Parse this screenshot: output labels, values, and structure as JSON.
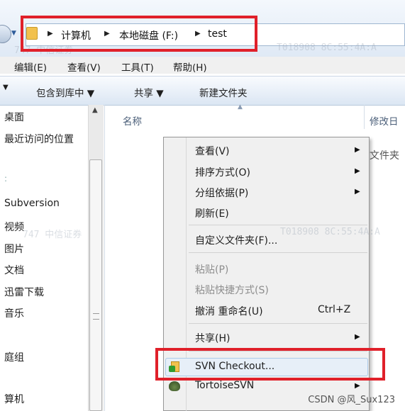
{
  "address": {
    "crumbs": [
      "计算机",
      "本地磁盘 (F:)",
      "test"
    ]
  },
  "menubar": {
    "items": [
      "编辑(E)",
      "查看(V)",
      "工具(T)",
      "帮助(H)"
    ]
  },
  "toolbar": {
    "include_library": "包含到库中 ▼",
    "share": "共享 ▼",
    "new_folder": "新建文件夹"
  },
  "nav": {
    "items": [
      "桌面",
      "最近访问的位置",
      "Subversion",
      "视频",
      "图片",
      "文档",
      "迅雷下载",
      "音乐",
      "庭组",
      "算机"
    ]
  },
  "columns": {
    "name": "名称",
    "modified": "修改日",
    "partial_row": "文件夹"
  },
  "context_menu": {
    "view": "查看(V)",
    "sort": "排序方式(O)",
    "group": "分组依据(P)",
    "refresh": "刷新(E)",
    "customize": "自定义文件夹(F)...",
    "paste": "粘贴(P)",
    "paste_shortcut": "粘贴快捷方式(S)",
    "undo_rename": "撤消 重命名(U)",
    "undo_shortcut": "Ctrl+Z",
    "share": "共享(H)",
    "svn_checkout": "SVN Checkout...",
    "tortoise": "TortoiseSVN"
  },
  "watermark": {
    "left": "747   中信证券",
    "right": "T018908   8C:55:4A:A",
    "mid_left": "747   中信证券",
    "mid_right": "T018908   8C:55:4A:A"
  },
  "credit": "CSDN @风_Sux123",
  "colors": {
    "highlight": "#e0202a",
    "folder": "#f2c14e"
  }
}
